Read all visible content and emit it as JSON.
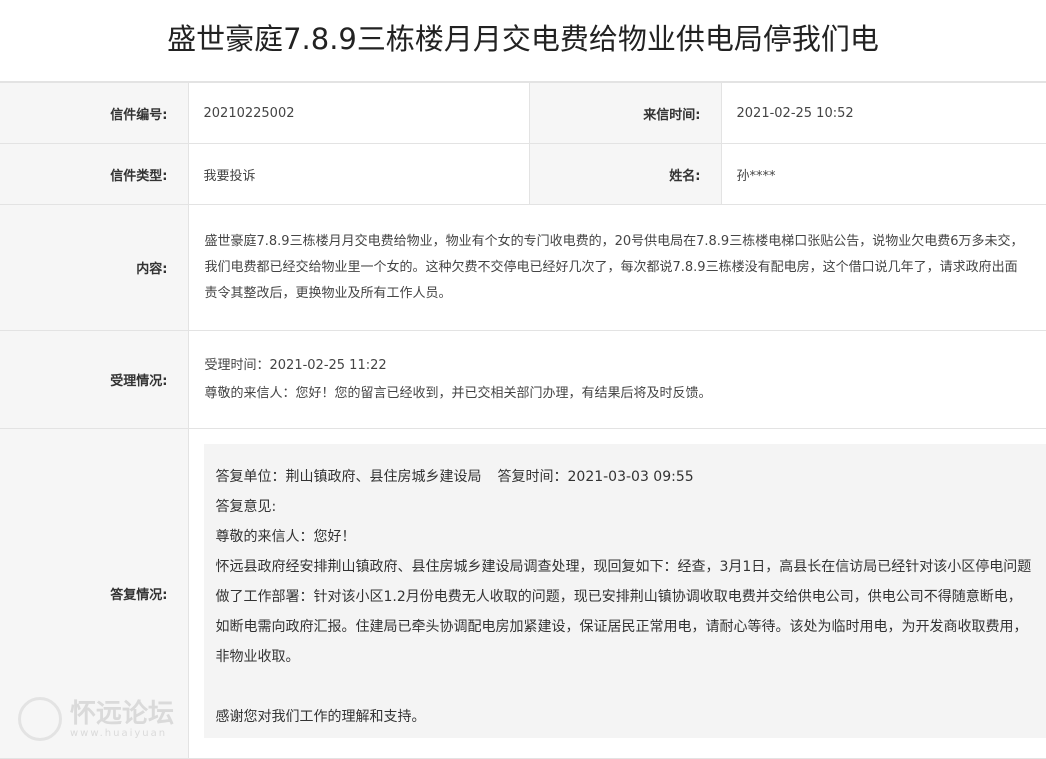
{
  "title": "盛世豪庭7.8.9三栋楼月月交电费给物业供电局停我们电",
  "letter": {
    "number_label": "信件编号:",
    "number": "20210225002",
    "time_label": "来信时间:",
    "time": "2021-02-25 10:52",
    "type_label": "信件类型:",
    "type": "我要投诉",
    "name_label": "姓名:",
    "name": "孙****",
    "content_label": "内容:",
    "content": "盛世豪庭7.8.9三栋楼月月交电费给物业，物业有个女的专门收电费的，20号供电局在7.8.9三栋楼电梯口张贴公告，说物业欠电费6万多未交，我们电费都已经交给物业里一个女的。这种欠费不交停电已经好几次了，每次都说7.8.9三栋楼没有配电房，这个借口说几年了，请求政府出面责令其整改后，更换物业及所有工作人员。"
  },
  "acceptance": {
    "label": "受理情况:",
    "time_text": "受理时间：2021-02-25 11:22",
    "message": "尊敬的来信人：您好！您的留言已经收到，并已交相关部门办理，有结果后将及时反馈。"
  },
  "reply": {
    "label": "答复情况:",
    "unit_text": "答复单位：荆山镇政府、县住房城乡建设局",
    "time_text": "答复时间：2021-03-03 09:55",
    "opinion_label": "答复意见:",
    "greeting": "尊敬的来信人：您好！",
    "body": "怀远县政府经安排荆山镇政府、县住房城乡建设局调查处理，现回复如下：经查，3月1日，高县长在信访局已经针对该小区停电问题做了工作部署：针对该小区1.2月份电费无人收取的问题，现已安排荆山镇协调收取电费并交给供电公司，供电公司不得随意断电，如断电需向政府汇报。住建局已牵头协调配电房加紧建设，保证居民正常用电，请耐心等待。该处为临时用电，为开发商收取费用，非物业收取。",
    "thanks": "感谢您对我们工作的理解和支持。"
  },
  "watermark": {
    "text": "怀远论坛",
    "sub": "www.huaiyuan"
  }
}
